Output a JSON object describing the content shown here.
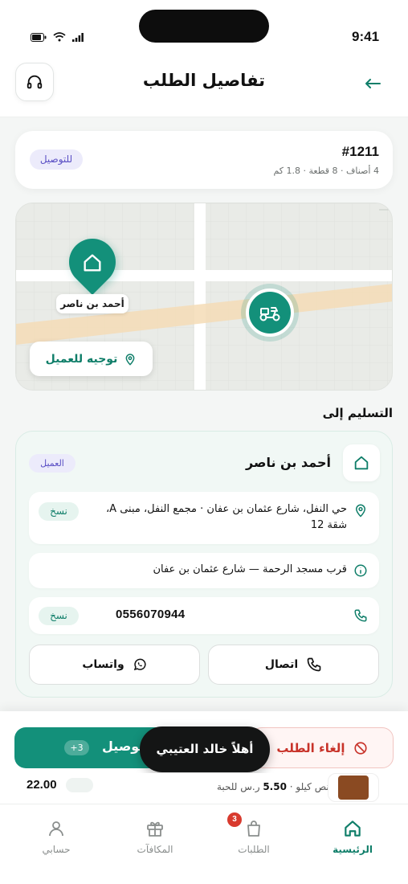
{
  "status_bar": {
    "time": "9:41"
  },
  "header": {
    "title": "تفاصيل الطلب",
    "back_icon": "arrow-left-icon",
    "support_icon": "headset-icon"
  },
  "order": {
    "number": "#1211",
    "meta": "4 أصناف · 8 قطعة · 1.8 كم",
    "badge": "للتوصيل"
  },
  "map": {
    "home_label": "أحمد بن ناصر",
    "directions_label": "توجيه للعميل"
  },
  "delivery_section": {
    "title": "التسليم إلى",
    "customer_name": "أحمد بن ناصر",
    "customer_badge": "العميل",
    "address": "حي النفل، شارع عثمان بن عفان · مجمع النفل، مبنى A، شقة 12",
    "landmark": "قرب مسجد الرحمة — شارع عثمان بن عفان",
    "phone": "0556070944",
    "copy_label": "نسخ",
    "call_label": "اتصال",
    "whatsapp_label": "واتساب"
  },
  "actions": {
    "deliver_label": "توصيل",
    "deliver_count": "+3",
    "cancel_label": "إلغاء الطلب"
  },
  "toast": {
    "text": "أهلاً خالد العتيبي"
  },
  "peek_item": {
    "price": "22.00",
    "desc_prefix": "نص كيلو · ",
    "desc_price": "5.50",
    "desc_suffix": " ر.س للحبة"
  },
  "tabs": [
    {
      "label": "الرئيسية",
      "icon": "home-icon",
      "active": true
    },
    {
      "label": "الطلبات",
      "icon": "bag-icon",
      "badge": "3"
    },
    {
      "label": "المكافآت",
      "icon": "gift-icon"
    },
    {
      "label": "حسابي",
      "icon": "user-icon"
    }
  ],
  "colors": {
    "primary": "#13907a",
    "danger": "#c8332a",
    "badge_bg": "#ecebfb",
    "badge_text": "#5a4fc4"
  }
}
